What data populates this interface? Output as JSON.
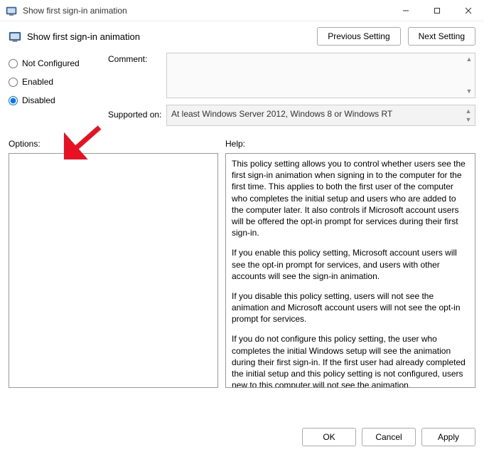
{
  "window": {
    "title": "Show first sign-in animation"
  },
  "header": {
    "setting_name": "Show first sign-in animation"
  },
  "nav": {
    "previous": "Previous Setting",
    "next": "Next Setting"
  },
  "radios": {
    "not_configured": "Not Configured",
    "enabled": "Enabled",
    "disabled": "Disabled",
    "selected": "disabled"
  },
  "labels": {
    "comment": "Comment:",
    "supported_on": "Supported on:",
    "options": "Options:",
    "help": "Help:"
  },
  "fields": {
    "comment_value": "",
    "supported_value": "At least Windows Server 2012, Windows 8 or Windows RT"
  },
  "help": {
    "p1": "This policy setting allows you to control whether users see the first sign-in animation when signing in to the computer for the first time.  This applies to both the first user of the computer who completes the initial setup and users who are added to the computer later.  It also controls if Microsoft account users will be offered the opt-in prompt for services during their first sign-in.",
    "p2": "If you enable this policy setting, Microsoft account users will see the opt-in prompt for services, and users with other accounts will see the sign-in animation.",
    "p3": "If you disable this policy setting, users will not see the animation and Microsoft account users will not see the opt-in prompt for services.",
    "p4": "If you do not configure this policy setting, the user who completes the initial Windows setup will see the animation during their first sign-in. If the first user had already completed the initial setup and this policy setting is not configured, users new to this computer will not see the animation."
  },
  "footer": {
    "ok": "OK",
    "cancel": "Cancel",
    "apply": "Apply"
  }
}
